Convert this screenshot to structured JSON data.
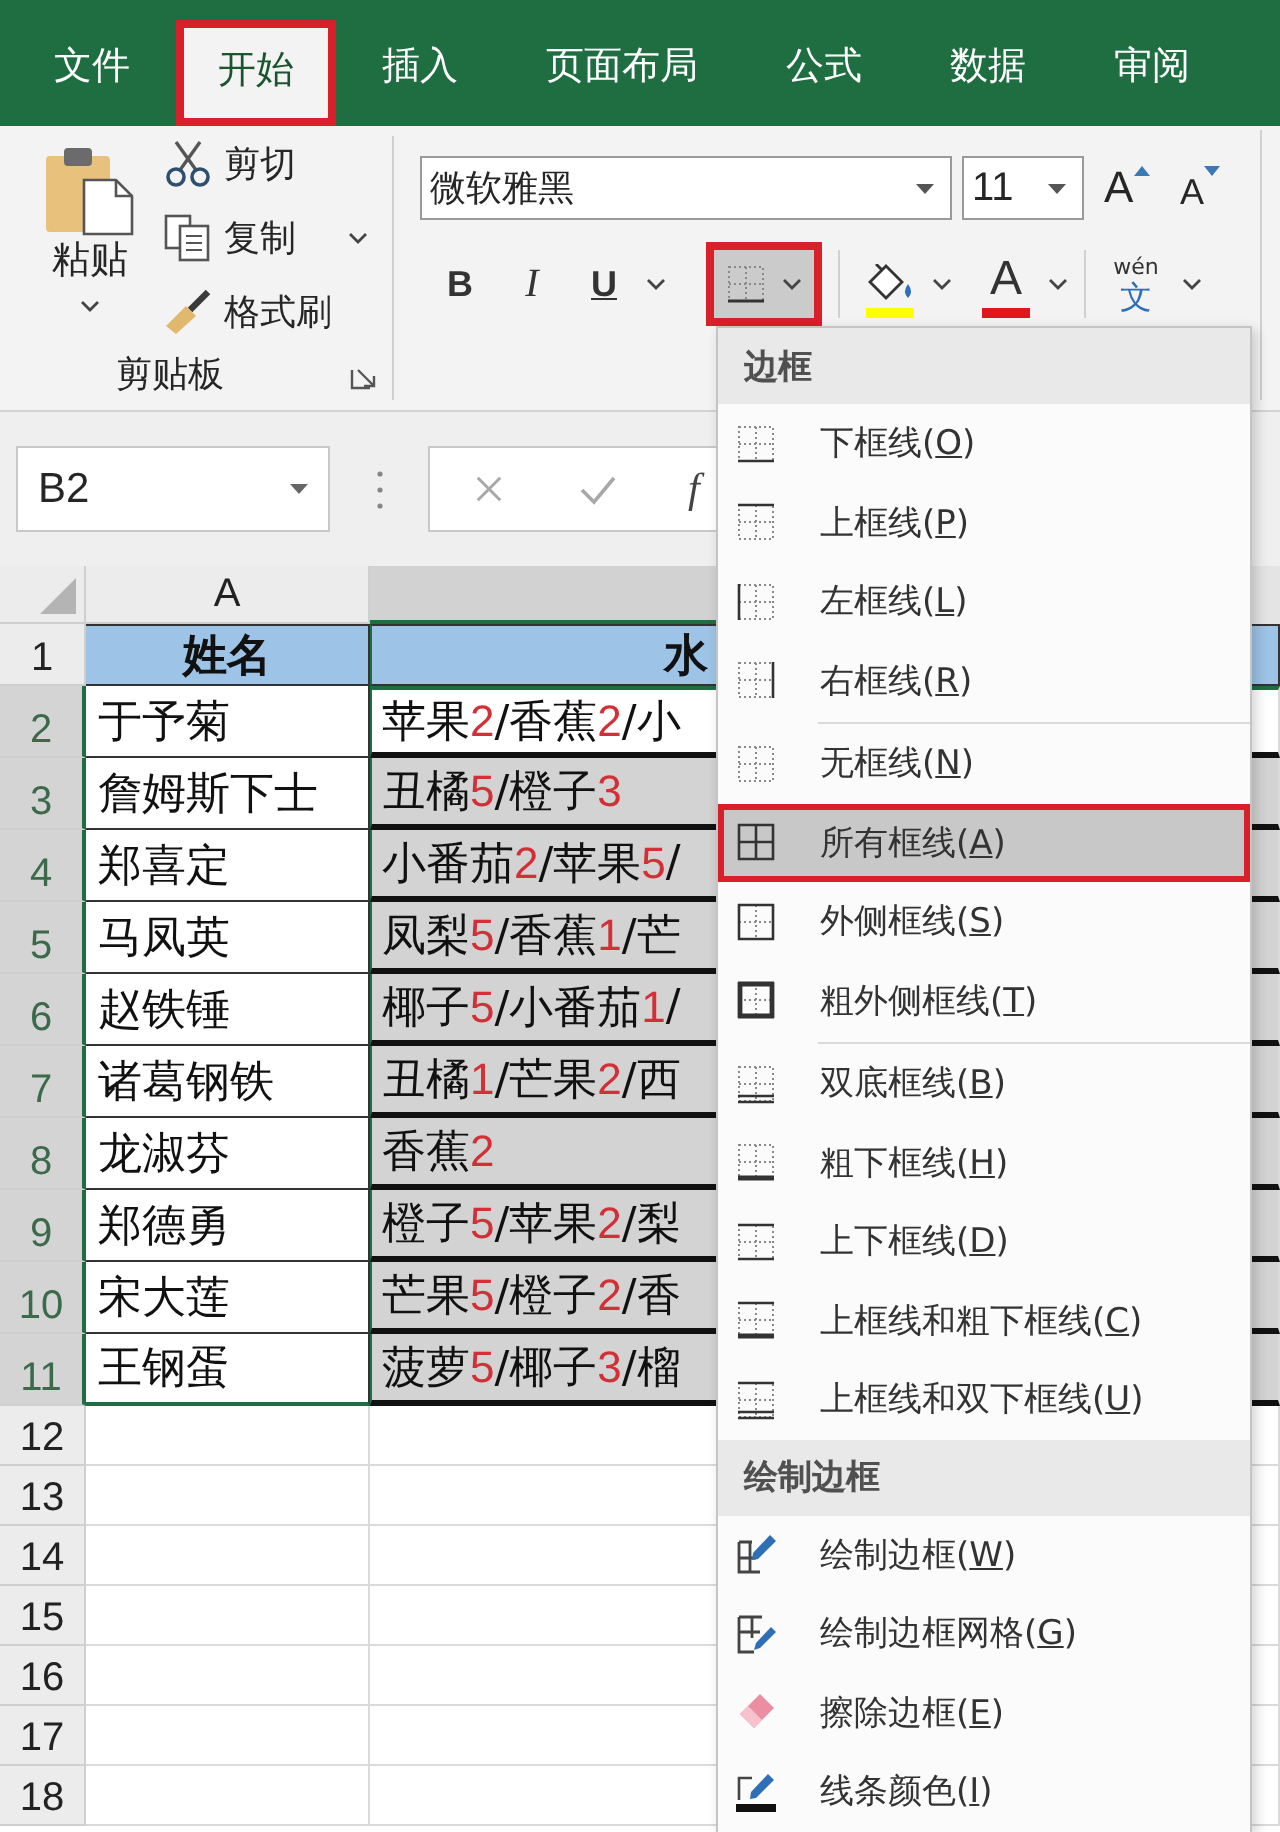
{
  "tabs": [
    {
      "label": "文件",
      "selected": false,
      "annotated": false
    },
    {
      "label": "开始",
      "selected": true,
      "annotated": true
    },
    {
      "label": "插入",
      "selected": false,
      "annotated": false
    },
    {
      "label": "页面布局",
      "selected": false,
      "annotated": false
    },
    {
      "label": "公式",
      "selected": false,
      "annotated": false
    },
    {
      "label": "数据",
      "selected": false,
      "annotated": false
    },
    {
      "label": "审阅",
      "selected": false,
      "annotated": false
    }
  ],
  "clipboard": {
    "paste": "粘贴",
    "cut": "剪切",
    "copy": "复制",
    "format_painter": "格式刷",
    "label": "剪贴板"
  },
  "font": {
    "name": "微软雅黑",
    "size": "11",
    "grow": "A",
    "shrink": "A",
    "bold": "B",
    "italic": "I",
    "underline": "U",
    "borders_button": {
      "open": true,
      "annotated": true
    },
    "fill_color": {
      "color": "#ffff00"
    },
    "font_color": {
      "label": "A",
      "color": "#e0161e"
    },
    "phonetic": {
      "pinyin": "wén",
      "character": "文"
    }
  },
  "formula_bar": {
    "name_box": "B2",
    "function_label": "f"
  },
  "sheet": {
    "columns": [
      {
        "label": "A",
        "selected": false
      },
      {
        "selected": true
      }
    ],
    "rows": [
      {
        "number": "1",
        "selected": false,
        "kind": "header",
        "name": "姓名",
        "fruits": {
          "runs": [
            {
              "text": "水",
              "kind": "name"
            }
          ]
        }
      },
      {
        "number": "2",
        "selected": true,
        "kind": "data",
        "name": "于予菊",
        "fruits": {
          "active": true,
          "runs": [
            {
              "text": "苹果",
              "kind": "name"
            },
            {
              "text": "2",
              "kind": "count"
            },
            {
              "text": "/香蕉",
              "kind": "name"
            },
            {
              "text": "2",
              "kind": "count"
            },
            {
              "text": "/小",
              "kind": "name"
            }
          ]
        }
      },
      {
        "number": "3",
        "selected": true,
        "kind": "data",
        "name": "詹姆斯下士",
        "fruits": {
          "active": false,
          "runs": [
            {
              "text": "丑橘",
              "kind": "name"
            },
            {
              "text": "5",
              "kind": "count"
            },
            {
              "text": "/橙子",
              "kind": "name"
            },
            {
              "text": "3",
              "kind": "count"
            }
          ]
        }
      },
      {
        "number": "4",
        "selected": true,
        "kind": "data",
        "name": "郑喜定",
        "fruits": {
          "active": false,
          "runs": [
            {
              "text": "小番茄",
              "kind": "name"
            },
            {
              "text": "2",
              "kind": "count"
            },
            {
              "text": "/苹果",
              "kind": "name"
            },
            {
              "text": "5",
              "kind": "count"
            },
            {
              "text": "/",
              "kind": "name"
            }
          ]
        }
      },
      {
        "number": "5",
        "selected": true,
        "kind": "data",
        "name": "马凤英",
        "fruits": {
          "active": false,
          "runs": [
            {
              "text": "凤梨",
              "kind": "name"
            },
            {
              "text": "5",
              "kind": "count"
            },
            {
              "text": "/香蕉",
              "kind": "name"
            },
            {
              "text": "1",
              "kind": "count"
            },
            {
              "text": "/芒",
              "kind": "name"
            }
          ]
        }
      },
      {
        "number": "6",
        "selected": true,
        "kind": "data",
        "name": "赵铁锤",
        "fruits": {
          "active": false,
          "runs": [
            {
              "text": "椰子",
              "kind": "name"
            },
            {
              "text": "5",
              "kind": "count"
            },
            {
              "text": "/小番茄",
              "kind": "name"
            },
            {
              "text": "1",
              "kind": "count"
            },
            {
              "text": "/",
              "kind": "name"
            }
          ]
        }
      },
      {
        "number": "7",
        "selected": true,
        "kind": "data",
        "name": "诸葛钢铁",
        "fruits": {
          "active": false,
          "runs": [
            {
              "text": "丑橘",
              "kind": "name"
            },
            {
              "text": "1",
              "kind": "count"
            },
            {
              "text": "/芒果",
              "kind": "name"
            },
            {
              "text": "2",
              "kind": "count"
            },
            {
              "text": "/西",
              "kind": "name"
            }
          ]
        }
      },
      {
        "number": "8",
        "selected": true,
        "kind": "data",
        "name": "龙淑芬",
        "fruits": {
          "active": false,
          "runs": [
            {
              "text": "香蕉",
              "kind": "name"
            },
            {
              "text": "2",
              "kind": "count"
            }
          ]
        }
      },
      {
        "number": "9",
        "selected": true,
        "kind": "data",
        "name": "郑德勇",
        "fruits": {
          "active": false,
          "runs": [
            {
              "text": "橙子",
              "kind": "name"
            },
            {
              "text": "5",
              "kind": "count"
            },
            {
              "text": "/苹果",
              "kind": "name"
            },
            {
              "text": "2",
              "kind": "count"
            },
            {
              "text": "/梨",
              "kind": "name"
            }
          ]
        }
      },
      {
        "number": "10",
        "selected": true,
        "kind": "data",
        "name": "宋大莲",
        "fruits": {
          "active": false,
          "runs": [
            {
              "text": "芒果",
              "kind": "name"
            },
            {
              "text": "5",
              "kind": "count"
            },
            {
              "text": "/橙子",
              "kind": "name"
            },
            {
              "text": "2",
              "kind": "count"
            },
            {
              "text": "/香",
              "kind": "name"
            }
          ]
        }
      },
      {
        "number": "11",
        "selected": true,
        "kind": "data",
        "name": "王钢蛋",
        "fruits": {
          "active": false,
          "runs": [
            {
              "text": "菠萝",
              "kind": "name"
            },
            {
              "text": "5",
              "kind": "count"
            },
            {
              "text": "/椰子",
              "kind": "name"
            },
            {
              "text": "3",
              "kind": "count"
            },
            {
              "text": "/榴",
              "kind": "name"
            }
          ]
        }
      },
      {
        "number": "12",
        "selected": false,
        "kind": "empty"
      },
      {
        "number": "13",
        "selected": false,
        "kind": "empty"
      },
      {
        "number": "14",
        "selected": false,
        "kind": "empty"
      },
      {
        "number": "15",
        "selected": false,
        "kind": "empty"
      },
      {
        "number": "16",
        "selected": false,
        "kind": "empty"
      },
      {
        "number": "17",
        "selected": false,
        "kind": "empty"
      },
      {
        "number": "18",
        "selected": false,
        "kind": "empty"
      }
    ]
  },
  "border_menu": {
    "sections": [
      {
        "title": "边框",
        "groups": [
          {
            "items": [
              {
                "label": "下框线(O)",
                "selected": false,
                "annotated": false
              },
              {
                "label": "上框线(P)",
                "selected": false,
                "annotated": false
              },
              {
                "label": "左框线(L)",
                "selected": false,
                "annotated": false
              },
              {
                "label": "右框线(R)",
                "selected": false,
                "annotated": false
              }
            ]
          },
          {
            "items": [
              {
                "label": "无框线(N)",
                "selected": false,
                "annotated": false
              },
              {
                "label": "所有框线(A)",
                "selected": true,
                "annotated": true
              },
              {
                "label": "外侧框线(S)",
                "selected": false,
                "annotated": false
              },
              {
                "label": "粗外侧框线(T)",
                "selected": false,
                "annotated": false
              }
            ]
          },
          {
            "items": [
              {
                "label": "双底框线(B)",
                "selected": false,
                "annotated": false
              },
              {
                "label": "粗下框线(H)",
                "selected": false,
                "annotated": false
              },
              {
                "label": "上下框线(D)",
                "selected": false,
                "annotated": false
              },
              {
                "label": "上框线和粗下框线(C)",
                "selected": false,
                "annotated": false
              },
              {
                "label": "上框线和双下框线(U)",
                "selected": false,
                "annotated": false
              }
            ]
          }
        ]
      },
      {
        "title": "绘制边框",
        "groups": [
          {
            "items": [
              {
                "label": "绘制边框(W)",
                "selected": false,
                "annotated": false
              },
              {
                "label": "绘制边框网格(G)",
                "selected": false,
                "annotated": false
              },
              {
                "label": "擦除边框(E)",
                "selected": false,
                "annotated": false
              },
              {
                "label": "线条颜色(I)",
                "selected": false,
                "annotated": false
              }
            ]
          }
        ]
      }
    ]
  }
}
